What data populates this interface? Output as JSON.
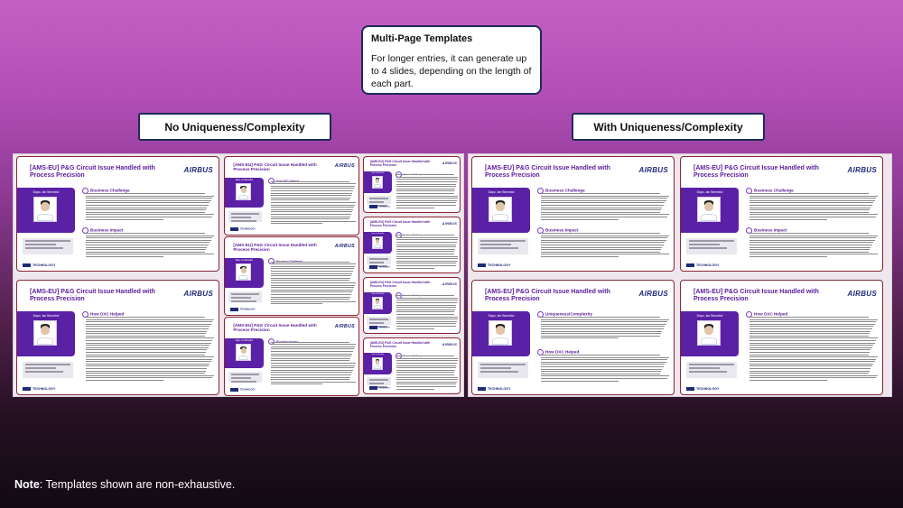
{
  "callout": {
    "title": "Multi-Page Templates",
    "body": "For longer entries, it can generate up to 4 slides, depending on the length of each part."
  },
  "labels": {
    "left": "No Uniqueness/Complexity",
    "right": "With Uniqueness/Complexity"
  },
  "slide": {
    "title": "[AMS-EU]   P&G Circuit Issue Handled with Process Precision",
    "logo": "AIRBUS",
    "person": "Dapo, Ian Benedict",
    "footer": "TECHNOLOGY",
    "sections": {
      "challenge": "Business Challenge",
      "impact": "Business Impact",
      "helped": "How DXC Helped",
      "uniqueness": "Uniqueness/Complexity"
    }
  },
  "note": {
    "label": "Note",
    "text": ": Templates shown are non-exhaustive."
  }
}
